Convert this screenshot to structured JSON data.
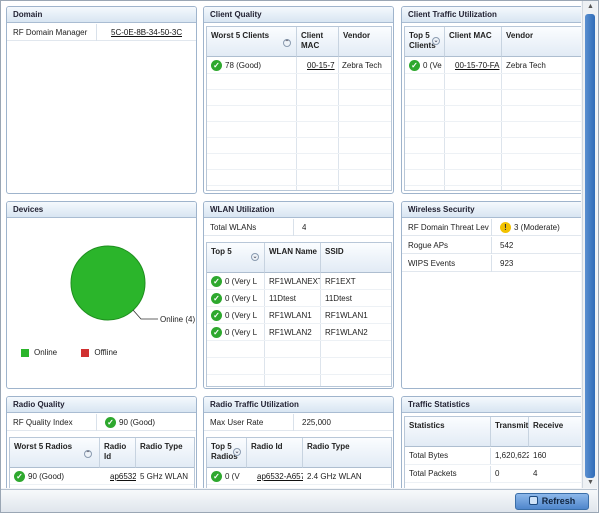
{
  "domain_panel": {
    "title": "Domain",
    "rows": [
      {
        "label": "RF Domain Manager",
        "value": "5C-0E-8B-34-50-3C"
      }
    ]
  },
  "client_quality": {
    "title": "Client Quality",
    "headers": [
      "Worst 5 Clients",
      "Client MAC",
      "Vendor"
    ],
    "rows": [
      {
        "quality": "78 (Good)",
        "mac": "00-15-7",
        "vendor": "Zebra Tech"
      }
    ]
  },
  "client_traffic": {
    "title": "Client Traffic Utilization",
    "headers": [
      "Top 5 Clients",
      "Client MAC",
      "Vendor"
    ],
    "rows": [
      {
        "value": "0 (Ve",
        "mac": "00-15-70-FA",
        "vendor": "Zebra Tech"
      }
    ]
  },
  "devices": {
    "title": "Devices",
    "pie_label": "Online (4)",
    "legend_online": "Online",
    "legend_offline": "Offline",
    "online_color": "#2bb52b",
    "offline_color": "#d03030"
  },
  "wlan_util": {
    "title": "WLAN Utilization",
    "total_label": "Total WLANs",
    "total_value": "4",
    "headers": [
      "Top 5",
      "WLAN Name",
      "SSID"
    ],
    "rows": [
      {
        "util": "0 (Very L",
        "name": "RF1WLANEXT",
        "ssid": "RF1EXT"
      },
      {
        "util": "0 (Very L",
        "name": "11Dtest",
        "ssid": "11Dtest"
      },
      {
        "util": "0 (Very L",
        "name": "RF1WLAN1",
        "ssid": "RF1WLAN1"
      },
      {
        "util": "0 (Very L",
        "name": "RF1WLAN2",
        "ssid": "RF1WLAN2"
      }
    ]
  },
  "wireless_security": {
    "title": "Wireless Security",
    "rows": [
      {
        "label": "RF Domain Threat Lev",
        "value": "3 (Moderate)"
      },
      {
        "label": "Rogue APs",
        "value": "542"
      },
      {
        "label": "WIPS Events",
        "value": "923"
      }
    ]
  },
  "radio_quality": {
    "title": "Radio Quality",
    "index_label": "RF Quality Index",
    "index_value": "90 (Good)",
    "headers": [
      "Worst 5 Radios",
      "Radio Id",
      "Radio Type"
    ],
    "rows": [
      {
        "quality": "90 (Good)",
        "radio_id": "ap6532",
        "type": "5 GHz WLAN"
      }
    ]
  },
  "radio_traffic": {
    "title": "Radio Traffic Utilization",
    "rate_label": "Max User Rate",
    "rate_value": "225,000",
    "headers": [
      "Top 5 Radios",
      "Radio Id",
      "Radio Type"
    ],
    "rows": [
      {
        "value": "0 (V",
        "radio_id": "ap6532-A657",
        "type": "2.4 GHz WLAN"
      }
    ]
  },
  "traffic_stats": {
    "title": "Traffic Statistics",
    "headers": [
      "Statistics",
      "Transmit",
      "Receive"
    ],
    "rows": [
      {
        "label": "Total Bytes",
        "tx": "1,620,622",
        "rx": "160"
      },
      {
        "label": "Total Packets",
        "tx": "0",
        "rx": "4"
      }
    ]
  },
  "footer": {
    "refresh_label": "Refresh"
  }
}
